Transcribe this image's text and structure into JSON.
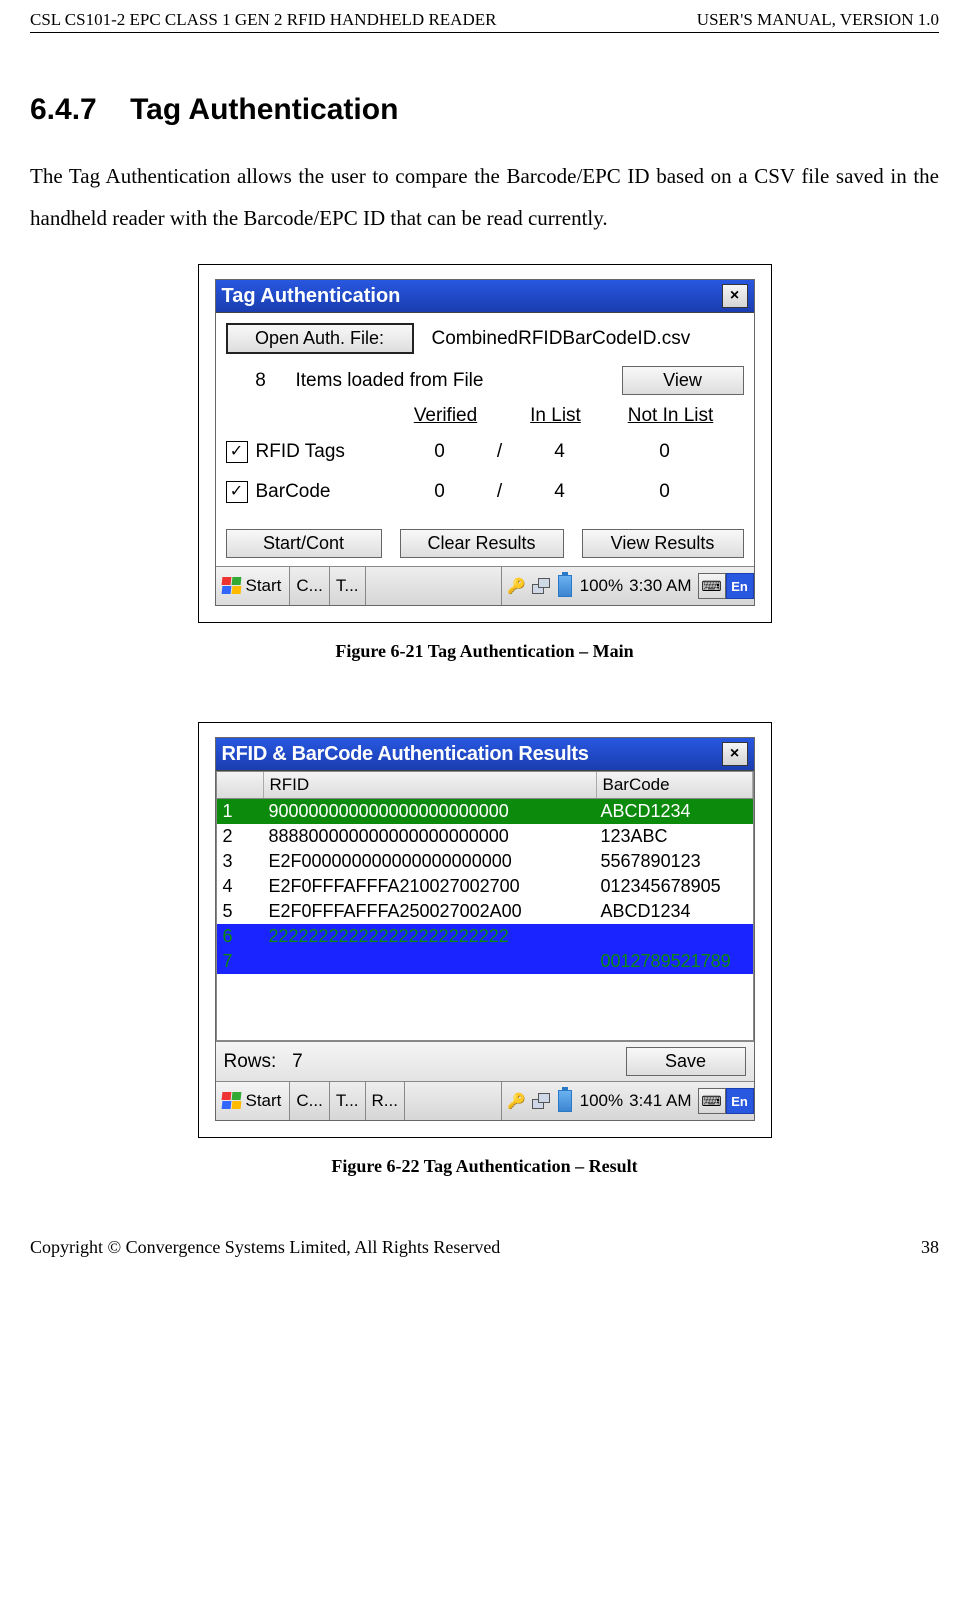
{
  "header": {
    "left": "CSL CS101-2 EPC CLASS 1 GEN 2 RFID HANDHELD READER",
    "right": "USER'S  MANUAL,   VERSION  1.0"
  },
  "footer": {
    "left": "Copyright © Convergence Systems Limited, All Rights Reserved",
    "right": "38"
  },
  "section": {
    "number": "6.4.7",
    "title": "Tag Authentication"
  },
  "paragraph": "The Tag Authentication allows the user to compare the Barcode/EPC ID based on a CSV file saved in the handheld reader with the Barcode/EPC ID that can be read currently.",
  "captions": {
    "fig1": "Figure 6-21          Tag Authentication – Main",
    "fig2": "Figure 6-22          Tag Authentication – Result"
  },
  "fig1": {
    "title": "Tag Authentication",
    "close": "×",
    "open_btn": "Open Auth. File:",
    "file_name": "CombinedRFIDBarCodeID.csv",
    "items_count": "8",
    "items_label": "Items loaded from File",
    "view_btn": "View",
    "col_verified": "Verified",
    "col_inlist": "In List",
    "col_notinlist": "Not In List",
    "r1_label": "RFID Tags",
    "r1_v": "0",
    "r1_il": "4",
    "r1_nil": "0",
    "r2_label": "BarCode",
    "r2_v": "0",
    "r2_il": "4",
    "r2_nil": "0",
    "btn_start": "Start/Cont",
    "btn_clear": "Clear Results",
    "btn_viewres": "View Results",
    "tb_start": "Start",
    "tb_c": "C...",
    "tb_t": "T...",
    "batt": "100%",
    "time": "3:30 AM",
    "en": "En"
  },
  "fig2": {
    "title": "RFID & BarCode Authentication Results",
    "close": "×",
    "col_idx": " ",
    "col_rfid": "RFID",
    "col_bar": "BarCode",
    "rows": [
      {
        "i": "1",
        "rfid": "900000000000000000000000",
        "bar": "ABCD1234",
        "bg": "#0b8a0b",
        "fg": "#fff"
      },
      {
        "i": "2",
        "rfid": "888800000000000000000000",
        "bar": "123ABC",
        "bg": "",
        "fg": ""
      },
      {
        "i": "3",
        "rfid": "E2F000000000000000000000",
        "bar": "5567890123",
        "bg": "",
        "fg": ""
      },
      {
        "i": "4",
        "rfid": "E2F0FFFAFFFA210027002700",
        "bar": "012345678905",
        "bg": "",
        "fg": ""
      },
      {
        "i": "5",
        "rfid": "E2F0FFFAFFFA250027002A00",
        "bar": "ABCD1234",
        "bg": "",
        "fg": ""
      },
      {
        "i": "6",
        "rfid": "222222222222222222222222",
        "bar": "",
        "bg": "#1a24ff",
        "fg": "#0b8a0b"
      },
      {
        "i": "7",
        "rfid": "",
        "bar": "0012789521789",
        "bg": "#1a24ff",
        "fg": "#0b8a0b"
      }
    ],
    "rows_label": "Rows:",
    "rows_val": "7",
    "save_btn": "Save",
    "tb_start": "Start",
    "tb_c": "C...",
    "tb_t": "T...",
    "tb_r": "R...",
    "batt": "100%",
    "time": "3:41 AM",
    "en": "En"
  }
}
